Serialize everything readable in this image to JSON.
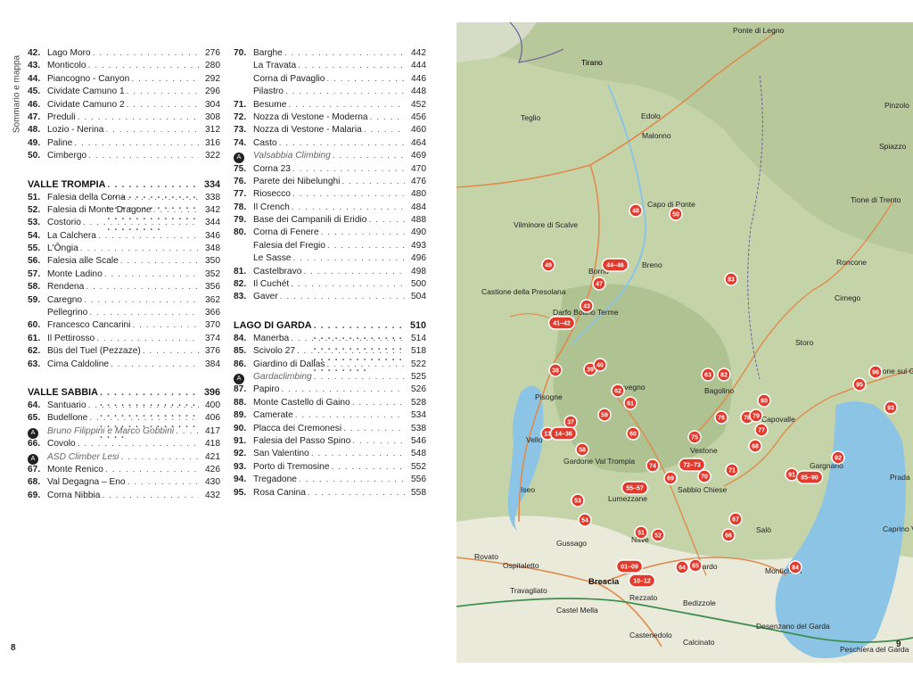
{
  "sidebar_label": "Sommario e mappa",
  "left_page_number": "8",
  "right_page_number": "9",
  "column1": [
    {
      "type": "entry",
      "num": "42.",
      "name": "Lago Moro",
      "page": "276"
    },
    {
      "type": "entry",
      "num": "43.",
      "name": "Monticolo",
      "page": "280"
    },
    {
      "type": "entry",
      "num": "44.",
      "name": "Piancogno - Canyon",
      "page": "292"
    },
    {
      "type": "entry",
      "num": "45.",
      "name": "Cividate Camuno 1",
      "page": "296"
    },
    {
      "type": "entry",
      "num": "46.",
      "name": "Cividate Camuno 2",
      "page": "304"
    },
    {
      "type": "entry",
      "num": "47.",
      "name": "Preduli",
      "page": "308"
    },
    {
      "type": "entry",
      "num": "48.",
      "name": "Lozio - Nerina",
      "page": "312"
    },
    {
      "type": "entry",
      "num": "49.",
      "name": "Paline",
      "page": "316"
    },
    {
      "type": "entry",
      "num": "50.",
      "name": "Cimbergo",
      "page": "322"
    },
    {
      "type": "gap"
    },
    {
      "type": "section",
      "name": "VALLE TROMPIA",
      "page": "334"
    },
    {
      "type": "entry",
      "num": "51.",
      "name": "Falesia della Corna",
      "page": "338"
    },
    {
      "type": "entry",
      "num": "52.",
      "name": "Falesia di Monte Dragone",
      "page": "342"
    },
    {
      "type": "entry",
      "num": "53.",
      "name": "Costorio",
      "page": "344"
    },
    {
      "type": "entry",
      "num": "54.",
      "name": "La Calchera",
      "page": "346"
    },
    {
      "type": "entry",
      "num": "55.",
      "name": "L'Ôngia",
      "page": "348"
    },
    {
      "type": "entry",
      "num": "56.",
      "name": "Falesia alle Scale",
      "page": "350"
    },
    {
      "type": "entry",
      "num": "57.",
      "name": "Monte Ladino",
      "page": "352"
    },
    {
      "type": "entry",
      "num": "58.",
      "name": "Rendena",
      "page": "356"
    },
    {
      "type": "entry",
      "num": "59.",
      "name": "Caregno",
      "page": "362"
    },
    {
      "type": "sub",
      "name": "Pellegrino",
      "page": "366"
    },
    {
      "type": "entry",
      "num": "60.",
      "name": "Francesco Cancarini",
      "page": "370"
    },
    {
      "type": "entry",
      "num": "61.",
      "name": "Il Pettirosso",
      "page": "374"
    },
    {
      "type": "entry",
      "num": "62.",
      "name": "Büs del Tuel (Pezzaze)",
      "page": "376"
    },
    {
      "type": "entry",
      "num": "63.",
      "name": "Cima Caldoline",
      "page": "384"
    },
    {
      "type": "gap"
    },
    {
      "type": "section",
      "name": "VALLE SABBIA",
      "page": "396"
    },
    {
      "type": "entry",
      "num": "64.",
      "name": "Santuario",
      "page": "400"
    },
    {
      "type": "entry",
      "num": "65.",
      "name": "Budellone",
      "page": "406"
    },
    {
      "type": "gym",
      "name": "Bruno Filippini e Marco Gobbini",
      "page": "417"
    },
    {
      "type": "entry",
      "num": "66.",
      "name": "Covolo",
      "page": "418"
    },
    {
      "type": "gym",
      "name": "ASD Climber Lesi",
      "page": "421"
    },
    {
      "type": "entry",
      "num": "67.",
      "name": "Monte Renico",
      "page": "426"
    },
    {
      "type": "entry",
      "num": "68.",
      "name": "Val Degagna – Eno",
      "page": "430"
    },
    {
      "type": "entry",
      "num": "69.",
      "name": "Corna Nibbia",
      "page": "432"
    }
  ],
  "column2": [
    {
      "type": "entry",
      "num": "70.",
      "name": "Barghe",
      "page": "442"
    },
    {
      "type": "sub",
      "name": "La Travata",
      "page": "444"
    },
    {
      "type": "sub",
      "name": "Corna di Pavaglio",
      "page": "446"
    },
    {
      "type": "sub",
      "name": "Pilastro",
      "page": "448"
    },
    {
      "type": "entry",
      "num": "71.",
      "name": "Besume",
      "page": "452"
    },
    {
      "type": "entry",
      "num": "72.",
      "name": "Nozza di Vestone - Moderna",
      "page": "456"
    },
    {
      "type": "entry",
      "num": "73.",
      "name": "Nozza di Vestone - Malaria",
      "page": "460"
    },
    {
      "type": "entry",
      "num": "74.",
      "name": "Casto",
      "page": "464"
    },
    {
      "type": "gym",
      "name": "Valsabbia Climbing",
      "page": "469"
    },
    {
      "type": "entry",
      "num": "75.",
      "name": "Corna 23",
      "page": "470"
    },
    {
      "type": "entry",
      "num": "76.",
      "name": "Parete dei Nibelunghi",
      "page": "476"
    },
    {
      "type": "entry",
      "num": "77.",
      "name": "Riosecco",
      "page": "480"
    },
    {
      "type": "entry",
      "num": "78.",
      "name": "Il Crench",
      "page": "484"
    },
    {
      "type": "entry",
      "num": "79.",
      "name": "Base dei Campanili di Eridio",
      "page": "488"
    },
    {
      "type": "entry",
      "num": "80.",
      "name": "Corna di Fenere",
      "page": "490"
    },
    {
      "type": "sub",
      "name": "Falesia del Fregio",
      "page": "493"
    },
    {
      "type": "sub",
      "name": "Le Sasse",
      "page": "496"
    },
    {
      "type": "entry",
      "num": "81.",
      "name": "Castelbravo",
      "page": "498"
    },
    {
      "type": "entry",
      "num": "82.",
      "name": "Il Cuchét",
      "page": "500"
    },
    {
      "type": "entry",
      "num": "83.",
      "name": "Gaver",
      "page": "504"
    },
    {
      "type": "gap"
    },
    {
      "type": "section",
      "name": "LAGO DI GARDA",
      "page": "510"
    },
    {
      "type": "entry",
      "num": "84.",
      "name": "Manerba",
      "page": "514"
    },
    {
      "type": "entry",
      "num": "85.",
      "name": "Scivolo 27",
      "page": "518"
    },
    {
      "type": "entry",
      "num": "86.",
      "name": "Giardino di Dallas",
      "page": "522"
    },
    {
      "type": "gym",
      "name": "Gardaclimbing",
      "page": "525"
    },
    {
      "type": "entry",
      "num": "87.",
      "name": "Papiro",
      "page": "526"
    },
    {
      "type": "entry",
      "num": "88.",
      "name": "Monte Castello di Gaino",
      "page": "528"
    },
    {
      "type": "entry",
      "num": "89.",
      "name": "Camerate",
      "page": "534"
    },
    {
      "type": "entry",
      "num": "90.",
      "name": "Placca dei Cremonesi",
      "page": "538"
    },
    {
      "type": "entry",
      "num": "91.",
      "name": "Falesia del Passo Spino",
      "page": "546"
    },
    {
      "type": "entry",
      "num": "92.",
      "name": "San Valentino",
      "page": "548"
    },
    {
      "type": "entry",
      "num": "93.",
      "name": "Porto di Tremosine",
      "page": "552"
    },
    {
      "type": "entry",
      "num": "94.",
      "name": "Tregadone",
      "page": "556"
    },
    {
      "type": "entry",
      "num": "95.",
      "name": "Rosa Canina",
      "page": "558"
    }
  ],
  "map": {
    "places": [
      {
        "name": "Ponte di Legno",
        "bold": false
      },
      {
        "name": "Tirano",
        "bold": false
      },
      {
        "name": "Teglio",
        "bold": false
      },
      {
        "name": "Edolo",
        "bold": false
      },
      {
        "name": "Malonno",
        "bold": false
      },
      {
        "name": "Pinzolo",
        "bold": false
      },
      {
        "name": "Spiazzo",
        "bold": false
      },
      {
        "name": "Capo di Ponte",
        "bold": false
      },
      {
        "name": "Tione di Trento",
        "bold": false
      },
      {
        "name": "Vilminore di Scalve",
        "bold": false
      },
      {
        "name": "Borno",
        "bold": false
      },
      {
        "name": "Breno",
        "bold": false
      },
      {
        "name": "Roncone",
        "bold": false
      },
      {
        "name": "Castione della Presolana",
        "bold": false
      },
      {
        "name": "Darfo Boario Terme",
        "bold": false
      },
      {
        "name": "Cimego",
        "bold": false
      },
      {
        "name": "Storo",
        "bold": false
      },
      {
        "name": "Pisogne",
        "bold": false
      },
      {
        "name": "Bagolino",
        "bold": false
      },
      {
        "name": "Limone sul Garda",
        "bold": false
      },
      {
        "name": "Bovegno",
        "bold": false
      },
      {
        "name": "Vello",
        "bold": false
      },
      {
        "name": "Capovalle",
        "bold": false
      },
      {
        "name": "Vestone",
        "bold": false
      },
      {
        "name": "Gardone Val Trompia",
        "bold": false
      },
      {
        "name": "Gargnano",
        "bold": false
      },
      {
        "name": "Iseo",
        "bold": false
      },
      {
        "name": "Sabbio Chiese",
        "bold": false
      },
      {
        "name": "Lumezzane",
        "bold": false
      },
      {
        "name": "Prada",
        "bold": false
      },
      {
        "name": "Nave",
        "bold": false
      },
      {
        "name": "Gavardo",
        "bold": false
      },
      {
        "name": "Salò",
        "bold": false
      },
      {
        "name": "Caprino Veronese",
        "bold": false
      },
      {
        "name": "Gussago",
        "bold": false
      },
      {
        "name": "Rovato",
        "bold": false
      },
      {
        "name": "Ospitaletto",
        "bold": false
      },
      {
        "name": "Brescia",
        "bold": true
      },
      {
        "name": "Montichiari",
        "bold": false
      },
      {
        "name": "Travagliato",
        "bold": false
      },
      {
        "name": "Rezzato",
        "bold": false
      },
      {
        "name": "Bedizzole",
        "bold": false
      },
      {
        "name": "Castel Mella",
        "bold": false
      },
      {
        "name": "Castenedolo",
        "bold": false
      },
      {
        "name": "Desenzano del Garda",
        "bold": false
      },
      {
        "name": "Calcinato",
        "bold": false
      },
      {
        "name": "Peschiera del Garda",
        "bold": false
      },
      {
        "name": "Tirano",
        "bold": false
      }
    ],
    "markers": [
      "48",
      "50",
      "49",
      "44–46",
      "47",
      "83",
      "43",
      "41–42",
      "38",
      "39",
      "40",
      "63",
      "82",
      "96",
      "95",
      "80",
      "62",
      "61",
      "76",
      "78",
      "79",
      "93",
      "77",
      "59",
      "37",
      "60",
      "75",
      "68",
      "13",
      "14–36",
      "58",
      "74",
      "72–73",
      "71",
      "91",
      "85–90",
      "92",
      "69",
      "70",
      "55–57",
      "53",
      "54",
      "67",
      "66",
      "51",
      "52",
      "01–09",
      "64",
      "65",
      "10–12",
      "84"
    ]
  }
}
